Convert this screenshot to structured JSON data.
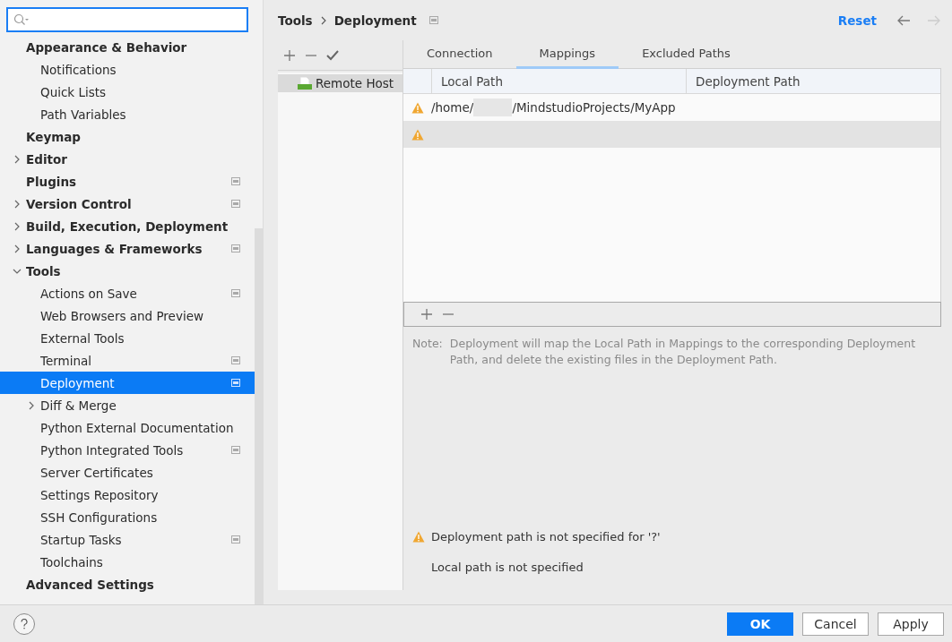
{
  "sidebar": {
    "items": [
      {
        "label": "Appearance & Behavior",
        "selected": false,
        "badge": false,
        "children": [
          {
            "label": "Notifications",
            "selected": false,
            "badge": false
          },
          {
            "label": "Quick Lists",
            "selected": false,
            "badge": false
          },
          {
            "label": "Path Variables",
            "selected": false,
            "badge": false
          }
        ]
      },
      {
        "label": "Keymap",
        "selected": false,
        "badge": false
      },
      {
        "label": "Editor",
        "selected": false,
        "badge": false,
        "expanded": false
      },
      {
        "label": "Plugins",
        "selected": false,
        "badge": true
      },
      {
        "label": "Version Control",
        "selected": false,
        "badge": true,
        "expanded": false
      },
      {
        "label": "Build, Execution, Deployment",
        "selected": false,
        "badge": false,
        "expanded": false
      },
      {
        "label": "Languages & Frameworks",
        "selected": false,
        "badge": true,
        "expanded": false
      },
      {
        "label": "Tools",
        "selected": false,
        "badge": false,
        "expanded": true,
        "children": [
          {
            "label": "Actions on Save",
            "selected": false,
            "badge": true
          },
          {
            "label": "Web Browsers and Preview",
            "selected": false,
            "badge": false
          },
          {
            "label": "External Tools",
            "selected": false,
            "badge": false
          },
          {
            "label": "Terminal",
            "selected": false,
            "badge": true
          },
          {
            "label": "Deployment",
            "selected": true,
            "badge": true
          },
          {
            "label": "Diff & Merge",
            "selected": false,
            "badge": false,
            "expanded": false
          },
          {
            "label": "Python External Documentation",
            "selected": false,
            "badge": false
          },
          {
            "label": "Python Integrated Tools",
            "selected": false,
            "badge": true
          },
          {
            "label": "Server Certificates",
            "selected": false,
            "badge": false
          },
          {
            "label": "Settings Repository",
            "selected": false,
            "badge": false
          },
          {
            "label": "SSH Configurations",
            "selected": false,
            "badge": false
          },
          {
            "label": "Startup Tasks",
            "selected": false,
            "badge": true
          },
          {
            "label": "Toolchains",
            "selected": false,
            "badge": false
          }
        ]
      },
      {
        "label": "Advanced Settings",
        "selected": false,
        "badge": false
      }
    ]
  },
  "breadcrumb": [
    "Tools",
    "Deployment"
  ],
  "reset": "Reset",
  "servers": [
    {
      "name": "Remote Host",
      "selected": true
    }
  ],
  "tabs": [
    {
      "label": "Connection",
      "selected": false
    },
    {
      "label": "Mappings",
      "selected": true
    },
    {
      "label": "Excluded Paths",
      "selected": false
    }
  ],
  "table": {
    "columns": [
      "Local Path",
      "Deployment Path"
    ],
    "rows": [
      {
        "warning": true,
        "selected": false,
        "local_path_start": "/home/",
        "redacted": true,
        "local_path_end": "/MindstudioProjects/MyApp"
      },
      {
        "warning": true,
        "selected": true
      }
    ]
  },
  "note": {
    "label": "Note:",
    "text": "Deployment will map the Local Path in Mappings to the corresponding Deployment Path, and delete the existing files in the Deployment Path."
  },
  "messages": [
    {
      "text": "Deployment path is not specified for '?'",
      "warning": true
    },
    {
      "text": "Local path is not specified",
      "warning": false
    }
  ],
  "buttons": [
    {
      "label": "OK",
      "primary": true
    },
    {
      "label": "Cancel",
      "primary": false
    },
    {
      "label": "Apply",
      "primary": false
    }
  ]
}
